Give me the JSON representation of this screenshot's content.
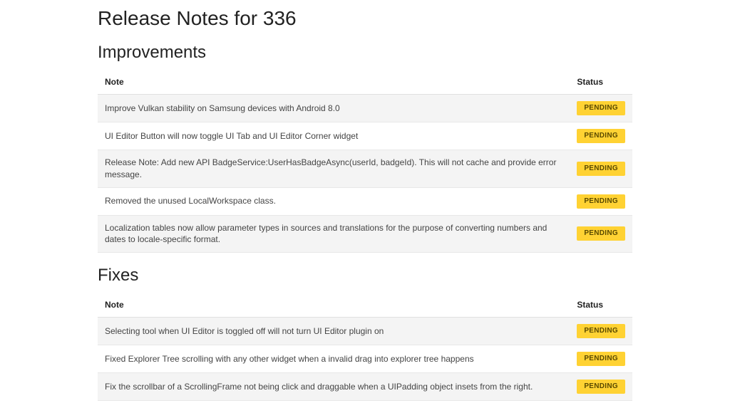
{
  "page_title": "Release Notes for 336",
  "columns": {
    "note": "Note",
    "status": "Status"
  },
  "sections": [
    {
      "heading": "Improvements",
      "rows": [
        {
          "note": "Improve Vulkan stability on Samsung devices with Android 8.0",
          "status": "PENDING"
        },
        {
          "note": "UI Editor Button will now toggle UI Tab and UI Editor Corner widget",
          "status": "PENDING"
        },
        {
          "note": "Release Note: Add new API BadgeService:UserHasBadgeAsync(userId, badgeId). This will not cache and provide error message.",
          "status": "PENDING"
        },
        {
          "note": "Removed the unused LocalWorkspace class.",
          "status": "PENDING"
        },
        {
          "note": "Localization tables now allow parameter types in sources and translations for the purpose of converting numbers and dates to locale-specific format.",
          "status": "PENDING"
        }
      ]
    },
    {
      "heading": "Fixes",
      "rows": [
        {
          "note": "Selecting tool when UI Editor is toggled off will not turn UI Editor plugin on",
          "status": "PENDING"
        },
        {
          "note": "Fixed Explorer Tree scrolling with any other widget when a invalid drag into explorer tree happens",
          "status": "PENDING"
        },
        {
          "note": "Fix the scrollbar of a ScrollingFrame not being click and draggable when a UIPadding object insets from the right.",
          "status": "PENDING"
        }
      ]
    }
  ]
}
